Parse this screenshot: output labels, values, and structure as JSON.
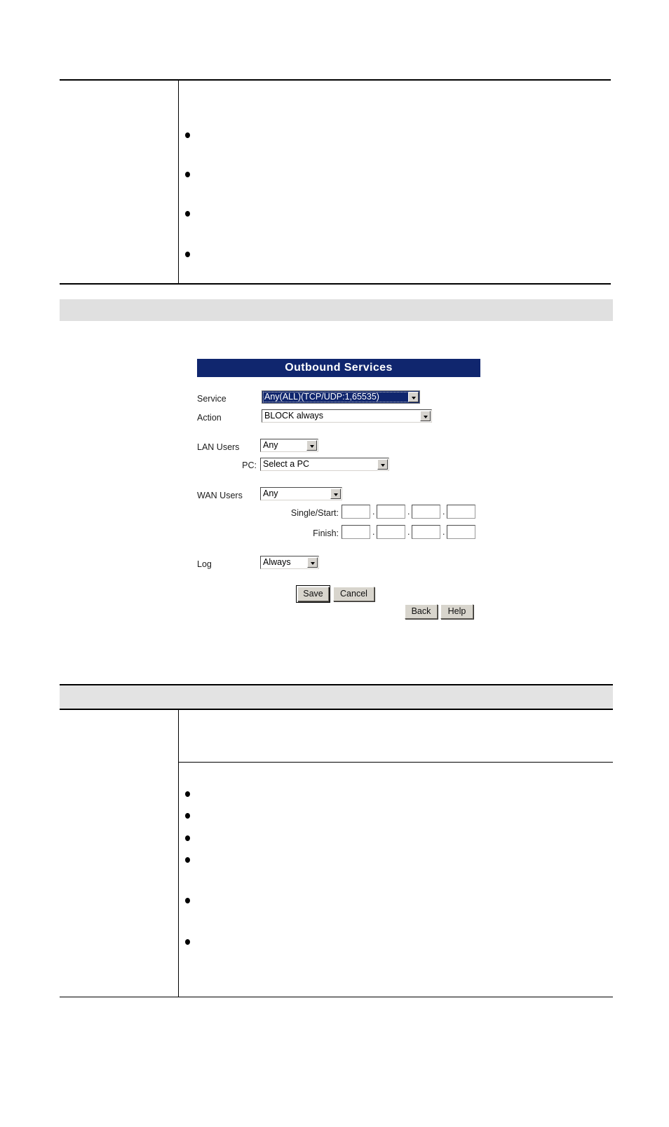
{
  "document": {
    "top_section": {
      "left_column_text": "",
      "bullet_items": [
        "",
        "",
        "",
        ""
      ]
    },
    "section_band": {
      "label": ""
    },
    "bottom_section": {
      "header_band_label": "",
      "intro_left_label": "",
      "intro_text": "",
      "list_left_label": "",
      "bullet_items": [
        "",
        "",
        "",
        "",
        "",
        ""
      ]
    }
  },
  "router_panel": {
    "title": "Outbound Services",
    "accent_color": "#10266e",
    "fields": {
      "service": {
        "label": "Service",
        "value": "Any(ALL)(TCP/UDP:1,65535)",
        "focused": true
      },
      "action": {
        "label": "Action",
        "value": "BLOCK always"
      },
      "lan_users": {
        "label": "LAN Users",
        "value": "Any"
      },
      "pc": {
        "label": "PC:",
        "value": "Select a PC"
      },
      "wan_users": {
        "label": "WAN Users",
        "value": "Any"
      },
      "single_start": {
        "label": "Single/Start:",
        "octets": [
          "",
          "",
          "",
          ""
        ],
        "separator": "."
      },
      "finish": {
        "label": "Finish:",
        "octets": [
          "",
          "",
          "",
          ""
        ],
        "separator": "."
      },
      "log": {
        "label": "Log",
        "value": "Always"
      }
    },
    "buttons": {
      "save": "Save",
      "cancel": "Cancel",
      "back": "Back",
      "help": "Help"
    }
  }
}
